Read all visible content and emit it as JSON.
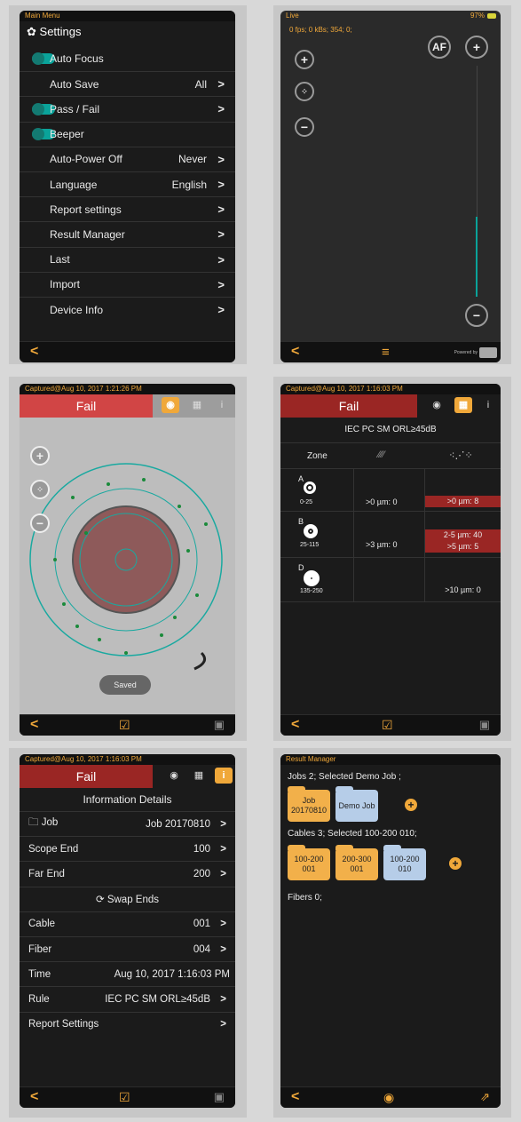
{
  "settings_screen": {
    "status": "Main Menu",
    "title": "Settings",
    "items": [
      {
        "label": "Auto Focus",
        "value": "",
        "toggle": true,
        "arrow": false
      },
      {
        "label": "Auto Save",
        "value": "All",
        "toggle": false,
        "arrow": true
      },
      {
        "label": "Pass / Fail",
        "value": "",
        "toggle": true,
        "arrow": true
      },
      {
        "label": "Beeper",
        "value": "",
        "toggle": true,
        "arrow": false
      },
      {
        "label": "Auto-Power Off",
        "value": "Never",
        "toggle": false,
        "arrow": true
      },
      {
        "label": "Language",
        "value": "English",
        "toggle": false,
        "arrow": true
      },
      {
        "label": "Report settings",
        "value": "",
        "toggle": false,
        "arrow": true
      },
      {
        "label": "Result Manager",
        "value": "",
        "toggle": false,
        "arrow": true
      },
      {
        "label": "Last",
        "value": "",
        "toggle": false,
        "arrow": true
      },
      {
        "label": "Import",
        "value": "",
        "toggle": false,
        "arrow": true
      },
      {
        "label": "Device Info",
        "value": "",
        "toggle": false,
        "arrow": true
      }
    ]
  },
  "live_screen": {
    "status": "Live",
    "battery": "97%",
    "stats": "0 fps; 0 kBs; 354; 0;",
    "af_label": "AF",
    "powered_by": "Powered by"
  },
  "capture_image_screen": {
    "status": "Captured@Aug 10, 2017 1:21:26 PM",
    "result": "Fail",
    "saved_label": "Saved"
  },
  "capture_table_screen": {
    "status": "Captured@Aug 10, 2017 1:16:03 PM",
    "result": "Fail",
    "rule": "IEC PC SM ORL≥45dB",
    "zone_header": "Zone",
    "zones": [
      {
        "letter": "A",
        "range": "0-25",
        "scratch": ">0 µm: 0",
        "defect": [
          ">0 µm: 8"
        ]
      },
      {
        "letter": "B",
        "range": "25-115",
        "scratch": ">3 µm: 0",
        "defect": [
          "2-5 µm: 40",
          ">5 µm: 5"
        ]
      },
      {
        "letter": "D",
        "range": "135-250",
        "scratch": "",
        "defect": [
          ">10 µm: 0"
        ]
      }
    ]
  },
  "info_screen": {
    "status": "Captured@Aug 10, 2017 1:16:03 PM",
    "result": "Fail",
    "title": "Information Details",
    "rows": [
      {
        "label": "Job",
        "value": "Job 20170810",
        "arrow": true
      },
      {
        "label": "Scope End",
        "value": "100",
        "arrow": true
      },
      {
        "label": "Far End",
        "value": "200",
        "arrow": true
      },
      {
        "label": "",
        "value": "Swap Ends",
        "arrow": false
      },
      {
        "label": "Cable",
        "value": "001",
        "arrow": true
      },
      {
        "label": "Fiber",
        "value": "004",
        "arrow": true
      },
      {
        "label": "Time",
        "value": "Aug 10, 2017 1:16:03 PM",
        "arrow": false
      },
      {
        "label": "Rule",
        "value": "IEC PC SM ORL≥45dB",
        "arrow": true
      },
      {
        "label": "Report Settings",
        "value": "",
        "arrow": true
      }
    ]
  },
  "result_manager_screen": {
    "status": "Result Manager",
    "jobs_label": "Jobs 2; Selected Demo Job ;",
    "jobs": [
      {
        "name": "Job\n20170810",
        "color": "yellow"
      },
      {
        "name": "Demo Job",
        "color": "blue"
      }
    ],
    "cables_label": "Cables 3; Selected 100-200 010;",
    "cables": [
      {
        "name": "100-200\n001",
        "color": "yellow"
      },
      {
        "name": "200-300\n001",
        "color": "yellow"
      },
      {
        "name": "100-200\n010",
        "color": "blue"
      }
    ],
    "fibers_label": "Fibers 0;"
  },
  "colors": {
    "accent": "#f0a83a",
    "fail": "#9a2624",
    "teal": "#0aa39a"
  }
}
